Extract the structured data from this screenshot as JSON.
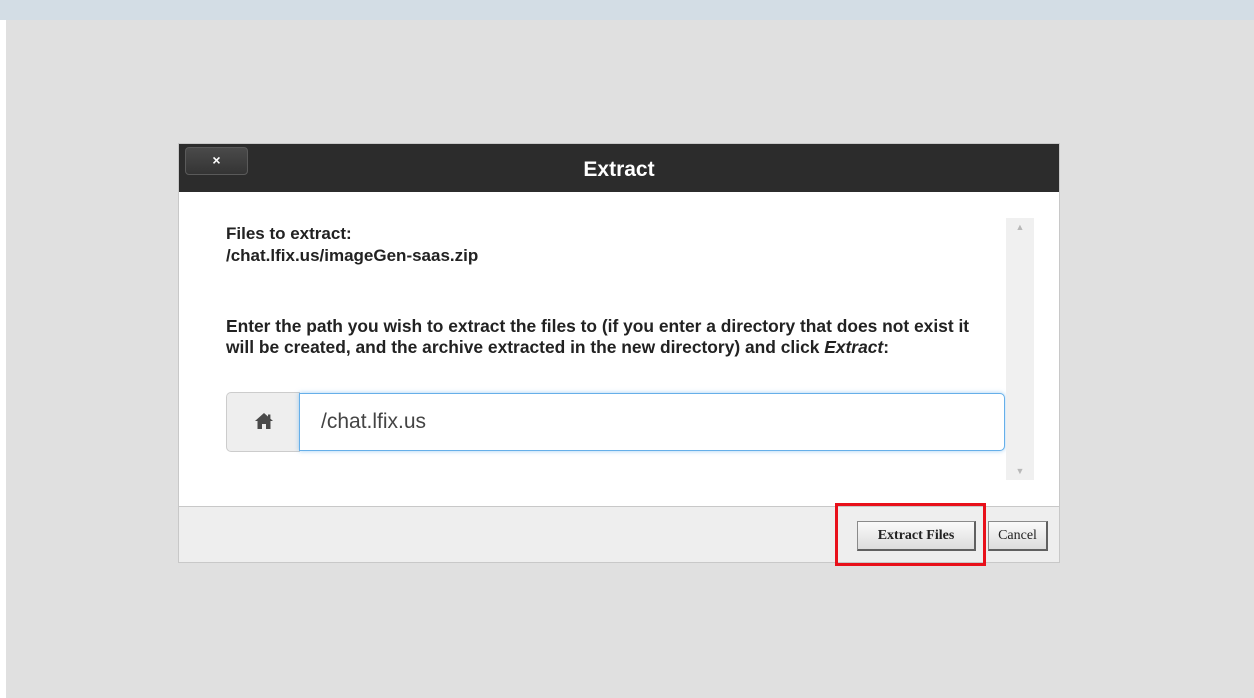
{
  "dialog": {
    "title": "Extract",
    "close_label": "×"
  },
  "content": {
    "files_label": "Files to extract:",
    "files_path": "/chat.lfix.us/imageGen-saas.zip",
    "instructions_before": "Enter the path you wish to extract the files to (if you enter a directory that does not exist it will be created, and the archive extracted in the new directory) and click ",
    "instructions_emphasis": "Extract",
    "instructions_after": ":",
    "path_value": "/chat.lfix.us"
  },
  "icons": {
    "home": "home-icon",
    "scroll_up": "▲",
    "scroll_down": "▼"
  },
  "footer": {
    "extract_label": "Extract Files",
    "cancel_label": "Cancel"
  },
  "colors": {
    "header_bg": "#2c2c2c",
    "overlay_bg": "#e0e0e0",
    "highlight": "#e8101a",
    "input_focus": "#66afe9"
  }
}
